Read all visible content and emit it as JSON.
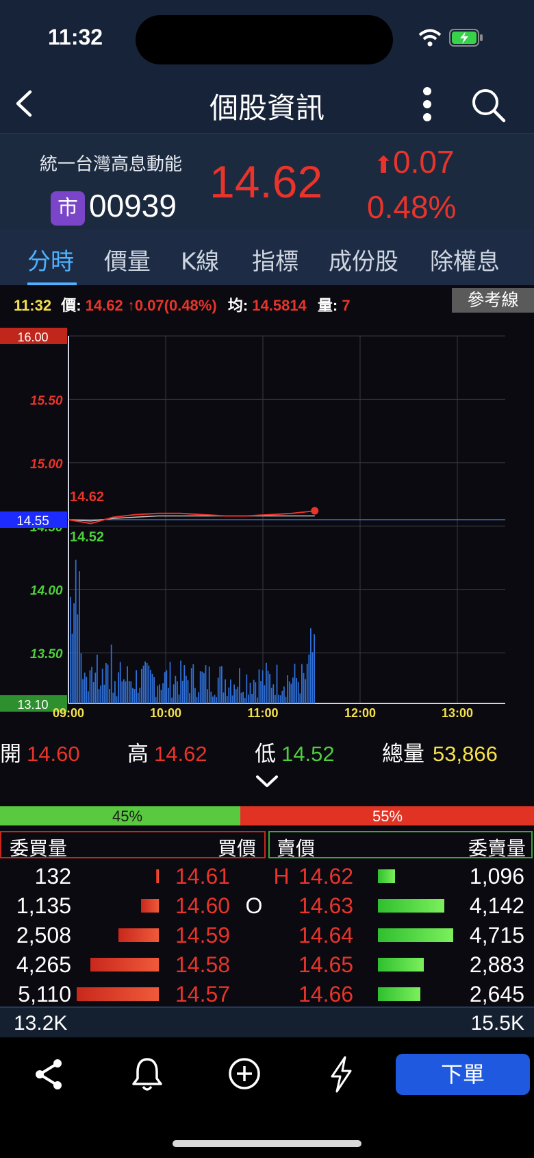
{
  "status_bar": {
    "time": "11:32"
  },
  "nav": {
    "title": "個股資訊"
  },
  "stock": {
    "name": "統一台灣高息動能",
    "market_badge": "市",
    "code": "00939",
    "price": "14.62",
    "change": "0.07",
    "change_pct": "0.48%"
  },
  "tabs": [
    "分時",
    "價量",
    "K線",
    "指標",
    "成份股",
    "除權息"
  ],
  "chart_info": {
    "time": "11:32",
    "price_label": "價:",
    "price": "14.62",
    "change": "0.07(0.48%)",
    "avg_label": "均:",
    "avg": "14.5814",
    "vol_label": "量:",
    "vol": "7",
    "ref_button": "參考線"
  },
  "chart_data": {
    "type": "line",
    "y_ticks": [
      "16.00",
      "15.50",
      "15.00",
      "14.50",
      "14.00",
      "13.50",
      "13.10"
    ],
    "ylim": [
      13.1,
      16.0
    ],
    "x_ticks": [
      "09:00",
      "10:00",
      "11:00",
      "12:00",
      "13:00"
    ],
    "reference_price": "14.55",
    "high_label": "14.62",
    "low_label": "14.52",
    "series": [
      {
        "values": [
          14.55,
          14.52,
          14.57,
          14.59,
          14.6,
          14.6,
          14.59,
          14.58,
          14.58,
          14.59,
          14.6,
          14.62
        ]
      },
      {
        "values": [
          14.55,
          14.54,
          14.56,
          14.57,
          14.58,
          14.58,
          14.58,
          14.58,
          14.58,
          14.58,
          14.58,
          14.58
        ]
      }
    ]
  },
  "ohlc": {
    "open_label": "開",
    "open": "14.60",
    "high_label": "高",
    "high": "14.62",
    "low_label": "低",
    "low": "14.52",
    "total_label": "總量",
    "total": "53,866"
  },
  "ratio": {
    "buy": "45%",
    "sell": "55%",
    "buy_fraction": 0.45
  },
  "book": {
    "headers": {
      "bid_vol": "委買量",
      "bid": "買價",
      "ask": "賣價",
      "ask_vol": "委賣量"
    },
    "rows": [
      {
        "bid_vol": "132",
        "bid": "14.61",
        "mark_l": "H",
        "ask": "14.62",
        "ask_vol": "1,096",
        "bid_frac": 0.03,
        "ask_frac": 0.23
      },
      {
        "bid_vol": "1,135",
        "bid": "14.60",
        "mark_l": "O",
        "ask": "14.63",
        "ask_vol": "4,142",
        "bid_frac": 0.22,
        "ask_frac": 0.88
      },
      {
        "bid_vol": "2,508",
        "bid": "14.59",
        "mark_l": "",
        "ask": "14.64",
        "ask_vol": "4,715",
        "bid_frac": 0.49,
        "ask_frac": 1.0
      },
      {
        "bid_vol": "4,265",
        "bid": "14.58",
        "mark_l": "",
        "ask": "14.65",
        "ask_vol": "2,883",
        "bid_frac": 0.83,
        "ask_frac": 0.61
      },
      {
        "bid_vol": "5,110",
        "bid": "14.57",
        "mark_l": "",
        "ask": "14.66",
        "ask_vol": "2,645",
        "bid_frac": 1.0,
        "ask_frac": 0.56
      }
    ],
    "total_bid": "13.2K",
    "total_ask": "15.5K"
  },
  "toolbar": {
    "order_button": "下單"
  },
  "icons": [
    "share-icon",
    "bell-icon",
    "add-circle-icon",
    "lightning-icon"
  ]
}
